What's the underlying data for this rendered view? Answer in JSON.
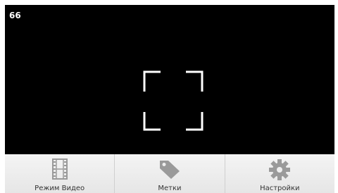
{
  "viewer": {
    "counter": "66"
  },
  "toolbar": {
    "items": [
      {
        "label": "Режим Видео",
        "icon": "film-icon"
      },
      {
        "label": "Метки",
        "icon": "tag-icon"
      },
      {
        "label": "Настройки",
        "icon": "gear-icon"
      }
    ]
  },
  "colors": {
    "viewer_bg": "#000000",
    "frame": "#ffffff",
    "toolbar_bg": "#eeeeee",
    "icon": "#9a9a9a"
  }
}
